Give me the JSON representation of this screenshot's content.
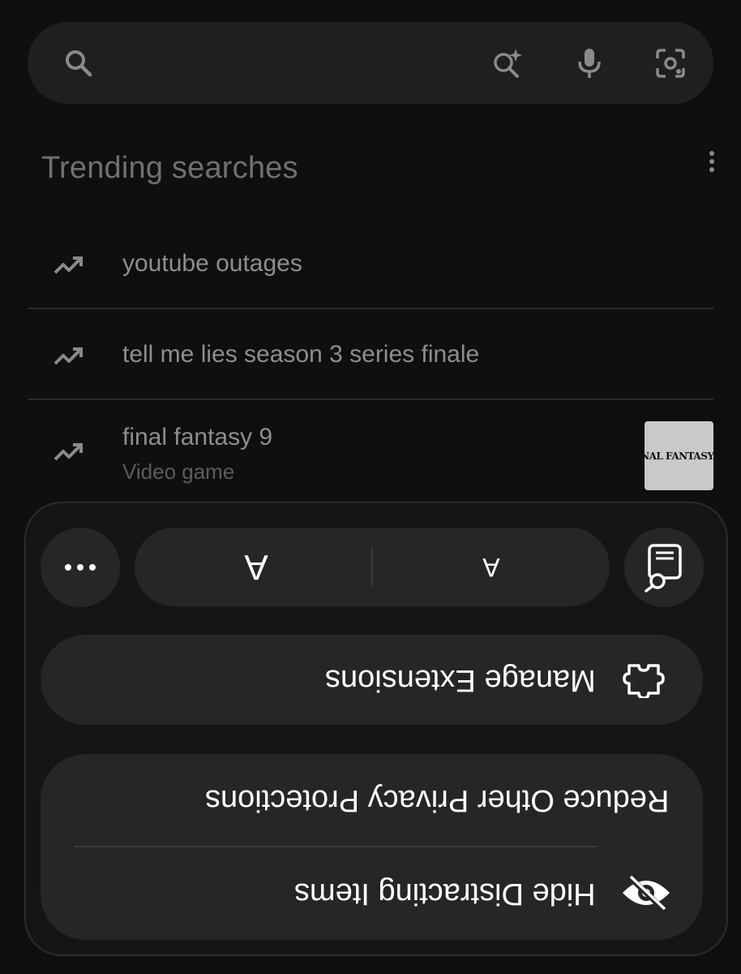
{
  "search": {
    "placeholder": ""
  },
  "icons": {
    "search": "search-icon",
    "ai_search": "sparkle-search-icon",
    "mic": "microphone-icon",
    "lens": "camera-lens-icon",
    "menu": "more-vert-icon",
    "trending": "trending-up-icon"
  },
  "trending": {
    "title": "Trending searches",
    "items": [
      {
        "text": "youtube outages",
        "subtitle": ""
      },
      {
        "text": "tell me lies season 3 series finale",
        "subtitle": ""
      },
      {
        "text": "final fantasy 9",
        "subtitle": "Video game",
        "thumbnail_text": "FINAL FANTASY IX"
      }
    ]
  },
  "popup": {
    "font_large": "A",
    "font_small": "A",
    "manage_extensions": "Manage Extensions",
    "reduce_privacy": "Reduce Other Privacy Protections",
    "hide_distracting": "Hide Distracting Items"
  },
  "colors": {
    "background": "#0f0f10",
    "surface": "#1f1f21",
    "panel": "#151517",
    "button": "#262628",
    "text_primary": "#ffffff",
    "text_muted": "#8e8e91"
  }
}
